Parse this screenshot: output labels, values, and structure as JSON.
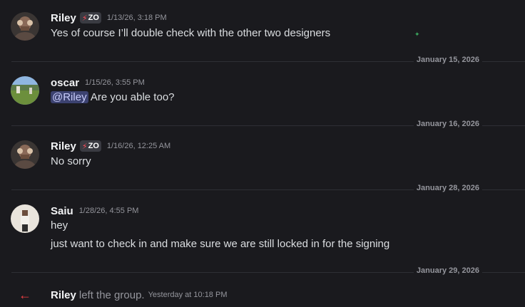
{
  "messages": [
    {
      "username": "Riley",
      "tag": "ZO",
      "timestamp": "1/13/26, 3:18 PM",
      "lines": [
        "Yes of course I’ll double check with the other two designers"
      ],
      "avatar": "riley-avatar"
    },
    {
      "username": "oscar",
      "timestamp": "1/15/26, 3:55 PM",
      "mention": "@Riley",
      "lines": [
        "Are you able too?"
      ],
      "avatar": "oscar-avatar"
    },
    {
      "username": "Riley",
      "tag": "ZO",
      "timestamp": "1/16/26, 12:25 AM",
      "lines": [
        "No sorry"
      ],
      "avatar": "riley-avatar"
    },
    {
      "username": "Saiu",
      "timestamp": "1/28/26, 4:55 PM",
      "lines": [
        "hey",
        "just want to check in and make sure we are still locked in for the signing"
      ],
      "avatar": "saiu-avatar"
    }
  ],
  "dividers": [
    "January 15, 2026",
    "January 16, 2026",
    "January 28, 2026",
    "January 29, 2026"
  ],
  "system": {
    "username": "Riley",
    "action": "left the group.",
    "timestamp": "Yesterday at 10:18 PM",
    "icon": "leave-arrow-icon"
  },
  "colors": {
    "background": "#1a1a1e",
    "mention_bg": "#3c4270",
    "leave_arrow": "#f23f43",
    "muted": "#94959c"
  }
}
